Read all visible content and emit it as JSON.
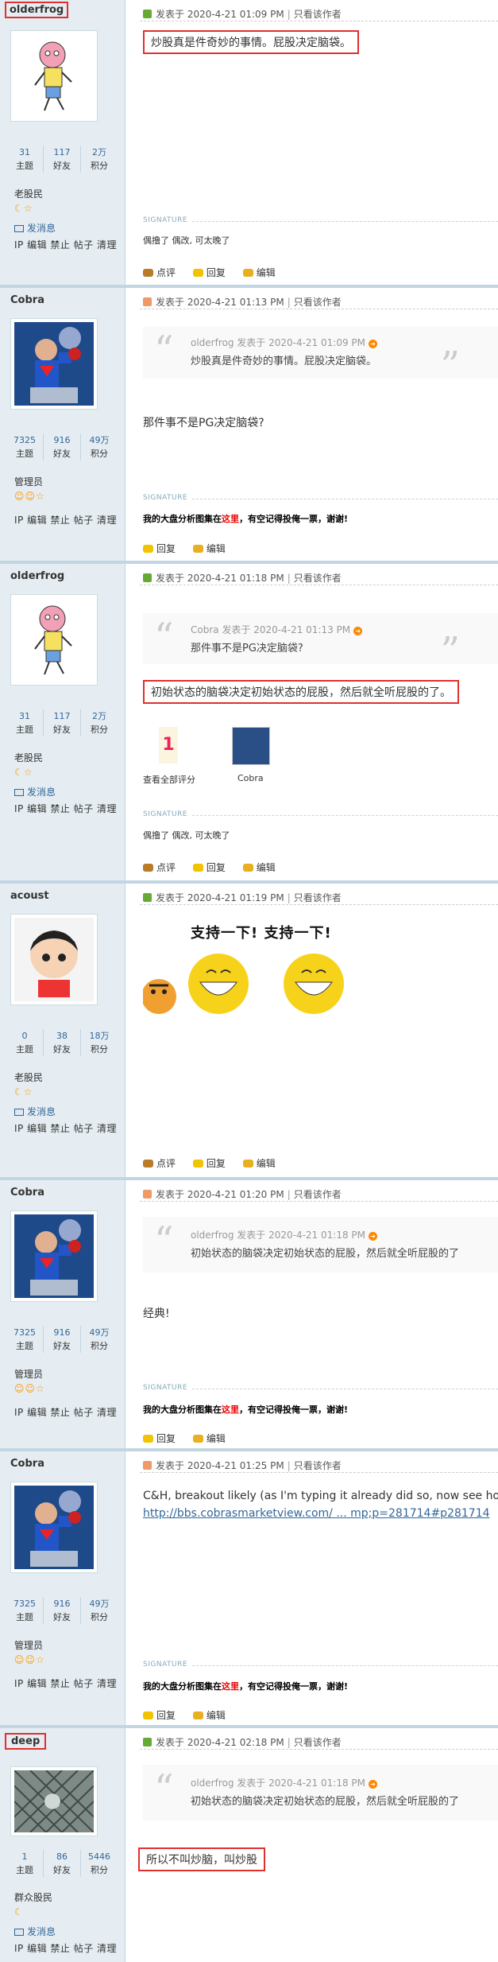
{
  "posts": [
    {
      "user": {
        "name": "olderfrog",
        "stats": [
          {
            "v": "31",
            "l": "主题"
          },
          {
            "v": "117",
            "l": "好友"
          },
          {
            "v": "2万",
            "l": "积分"
          }
        ],
        "rank": "老股民",
        "stars": "☾☆",
        "msg": "发消息",
        "actions": "IP 编辑 禁止 帖子 清理"
      },
      "header": {
        "posted": "发表于 2020-4-21 01:09 PM",
        "author_only": "只看该作者"
      },
      "content": "炒股真是件奇妙的事情。屁股决定脑袋。",
      "signature_label": "SIGNATURE",
      "signature": "偶撸了 偶改, 可太晚了",
      "footer": [
        "点评",
        "回复",
        "编辑"
      ]
    },
    {
      "user": {
        "name": "Cobra",
        "stats": [
          {
            "v": "7325",
            "l": "主题"
          },
          {
            "v": "916",
            "l": "好友"
          },
          {
            "v": "49万",
            "l": "积分"
          }
        ],
        "rank": "管理员",
        "stars": "☺☺☆",
        "actions": "IP 编辑 禁止 帖子 清理"
      },
      "header": {
        "posted": "发表于 2020-4-21 01:13 PM",
        "author_only": "只看该作者"
      },
      "quote": {
        "head": "olderfrog 发表于 2020-4-21 01:09 PM",
        "text": "炒股真是件奇妙的事情。屁股决定脑袋。"
      },
      "content": "那件事不是PG决定脑袋?",
      "signature_label": "SIGNATURE",
      "signature_pre": "我的大盘分析图集在",
      "signature_link": "这里",
      "signature_post": "，有空记得投俺一票，谢谢!",
      "footer": [
        "回复",
        "编辑"
      ]
    },
    {
      "user": {
        "name": "olderfrog",
        "stats": [
          {
            "v": "31",
            "l": "主题"
          },
          {
            "v": "117",
            "l": "好友"
          },
          {
            "v": "2万",
            "l": "积分"
          }
        ],
        "rank": "老股民",
        "stars": "☾☆",
        "msg": "发消息",
        "actions": "IP 编辑 禁止 帖子 清理"
      },
      "header": {
        "posted": "发表于 2020-4-21 01:18 PM",
        "author_only": "只看该作者"
      },
      "quote": {
        "head": "Cobra 发表于 2020-4-21 01:13 PM",
        "text": "那件事不是PG决定脑袋?"
      },
      "content": "初始状态的脑袋决定初始状态的屁股，然后就全听屁股的了。",
      "rating": {
        "count": "1",
        "label": "查看全部评分",
        "rater": "Cobra"
      },
      "signature_label": "SIGNATURE",
      "signature": "偶撸了 偶改, 可太晚了",
      "footer": [
        "点评",
        "回复",
        "编辑"
      ]
    },
    {
      "user": {
        "name": "acoust",
        "stats": [
          {
            "v": "0",
            "l": "主题"
          },
          {
            "v": "38",
            "l": "好友"
          },
          {
            "v": "18万",
            "l": "积分"
          }
        ],
        "rank": "老股民",
        "stars": "☾☆",
        "msg": "发消息",
        "actions": "IP 编辑 禁止 帖子 清理"
      },
      "header": {
        "posted": "发表于 2020-4-21 01:19 PM",
        "author_only": "只看该作者"
      },
      "banner": "支持一下! 支持一下!",
      "footer": [
        "点评",
        "回复",
        "编辑"
      ]
    },
    {
      "user": {
        "name": "Cobra",
        "stats": [
          {
            "v": "7325",
            "l": "主题"
          },
          {
            "v": "916",
            "l": "好友"
          },
          {
            "v": "49万",
            "l": "积分"
          }
        ],
        "rank": "管理员",
        "stars": "☺☺☆",
        "actions": "IP 编辑 禁止 帖子 清理"
      },
      "header": {
        "posted": "发表于 2020-4-21 01:20 PM",
        "author_only": "只看该作者"
      },
      "quote": {
        "head": "olderfrog 发表于 2020-4-21 01:18 PM",
        "text": "初始状态的脑袋决定初始状态的屁股，然后就全听屁股的了"
      },
      "content": "经典!",
      "signature_label": "SIGNATURE",
      "signature_pre": "我的大盘分析图集在",
      "signature_link": "这里",
      "signature_post": "，有空记得投俺一票，谢谢!",
      "footer": [
        "回复",
        "编辑"
      ]
    },
    {
      "user": {
        "name": "Cobra",
        "stats": [
          {
            "v": "7325",
            "l": "主题"
          },
          {
            "v": "916",
            "l": "好友"
          },
          {
            "v": "49万",
            "l": "积分"
          }
        ],
        "rank": "管理员",
        "stars": "☺☺☆",
        "actions": "IP 编辑 禁止 帖子 清理"
      },
      "header": {
        "posted": "发表于 2020-4-21 01:25 PM",
        "author_only": "只看该作者"
      },
      "content": "C&H, breakout likely (as I'm typing it already did so, now see how t",
      "link": "http://bbs.cobrasmarketview.com/ ... mp;p=281714#p281714",
      "signature_label": "SIGNATURE",
      "signature_pre": "我的大盘分析图集在",
      "signature_link": "这里",
      "signature_post": "，有空记得投俺一票，谢谢!",
      "footer": [
        "回复",
        "编辑"
      ]
    },
    {
      "user": {
        "name": "deep",
        "stats": [
          {
            "v": "1",
            "l": "主题"
          },
          {
            "v": "86",
            "l": "好友"
          },
          {
            "v": "5446",
            "l": "积分"
          }
        ],
        "rank": "群众股民",
        "stars": "☾",
        "msg": "发消息",
        "actions": "IP 编辑 禁止 帖子 清理"
      },
      "header": {
        "posted": "发表于 2020-4-21 02:18 PM",
        "author_only": "只看该作者"
      },
      "quote": {
        "head": "olderfrog 发表于 2020-4-21 01:18 PM",
        "text": "初始状态的脑袋决定初始状态的屁股，然后就全听屁股的了"
      },
      "content": "所以不叫炒脑，叫炒股"
    }
  ]
}
